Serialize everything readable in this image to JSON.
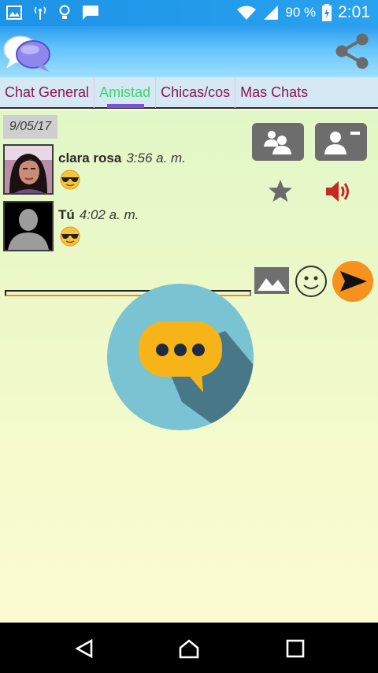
{
  "status_bar": {
    "battery_percent": "90 %",
    "time": "2:01",
    "icons": [
      "image-icon",
      "radio-signal-icon",
      "lightbulb-icon",
      "message-icon",
      "wifi-icon",
      "cell-signal-icon",
      "battery-charging-icon"
    ]
  },
  "app_bar": {
    "logo_icon": "chat-bubbles-logo-icon",
    "share_icon": "share-icon"
  },
  "tabs": [
    {
      "label": "Chat General",
      "active": false
    },
    {
      "label": "Amistad",
      "active": true
    },
    {
      "label": "Chicas/cos",
      "active": false
    },
    {
      "label": "Mas Chats",
      "active": false
    }
  ],
  "chat": {
    "date": "9/05/17",
    "messages": [
      {
        "name": "clara rosa",
        "time": "3:56 a. m.",
        "content_icon": "cool-emoji-icon",
        "avatar": "photo-avatar"
      },
      {
        "name": "Tú",
        "time": "4:02 a. m.",
        "content_icon": "cool-emoji-icon",
        "avatar": "default-avatar"
      }
    ]
  },
  "actions": {
    "group_icon": "group-users-icon",
    "remove_contact_icon": "remove-contact-icon",
    "favorite_icon": "star-icon",
    "sound_icon": "volume-icon"
  },
  "composer": {
    "message_value": "",
    "attach_image_icon": "image-icon",
    "emoji_icon": "smiley-icon",
    "send_icon": "send-icon"
  },
  "colors": {
    "accent_orange": "#f08a24",
    "tab_text": "#8b1552",
    "tab_active": "#3fd56f",
    "tab_indicator": "#7a52d8",
    "sound_red": "#c62828"
  },
  "nav_bar": [
    "back-icon",
    "home-icon",
    "recents-icon"
  ]
}
